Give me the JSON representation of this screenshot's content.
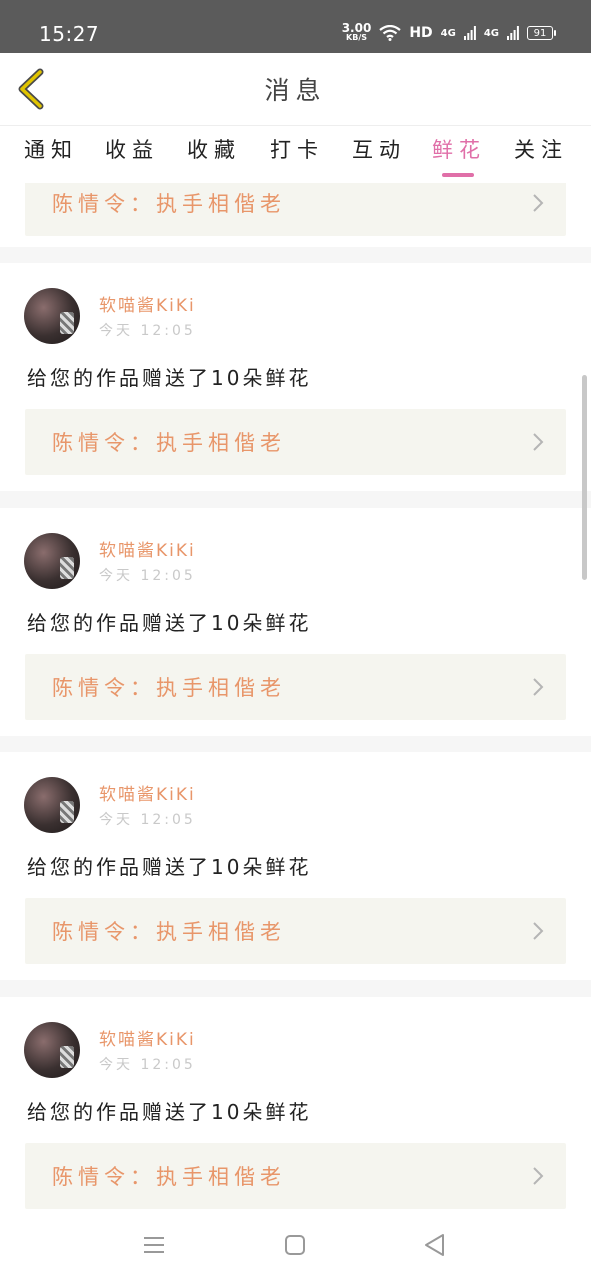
{
  "status": {
    "time": "15:27",
    "net_speed": "3.00",
    "net_unit": "KB/S",
    "hd": "HD",
    "sig1": "4G",
    "sig2": "4G",
    "battery": "91"
  },
  "header": {
    "title": "消息",
    "back_icon": "chevron-left-icon",
    "accent_color": "#e0c400"
  },
  "tabs": [
    {
      "label": "通知"
    },
    {
      "label": "收益"
    },
    {
      "label": "收藏"
    },
    {
      "label": "打卡"
    },
    {
      "label": "互动"
    },
    {
      "label": "鲜花",
      "active": true
    },
    {
      "label": "关注"
    }
  ],
  "active_color": "#e06fa8",
  "top_partial": {
    "work_title": "陈情令：执手相偕老"
  },
  "messages": [
    {
      "user": "软喵酱KiKi",
      "time": "今天 12:05",
      "text": "给您的作品赠送了10朵鲜花",
      "work_title": "陈情令：执手相偕老"
    },
    {
      "user": "软喵酱KiKi",
      "time": "今天 12:05",
      "text": "给您的作品赠送了10朵鲜花",
      "work_title": "陈情令：执手相偕老"
    },
    {
      "user": "软喵酱KiKi",
      "time": "今天 12:05",
      "text": "给您的作品赠送了10朵鲜花",
      "work_title": "陈情令：执手相偕老"
    },
    {
      "user": "软喵酱KiKi",
      "time": "今天 12:05",
      "text": "给您的作品赠送了10朵鲜花",
      "work_title": "陈情令：执手相偕老"
    }
  ],
  "navbar": {
    "menu_icon": "menu-icon",
    "home_icon": "square-home-icon",
    "back_icon": "triangle-back-icon"
  }
}
